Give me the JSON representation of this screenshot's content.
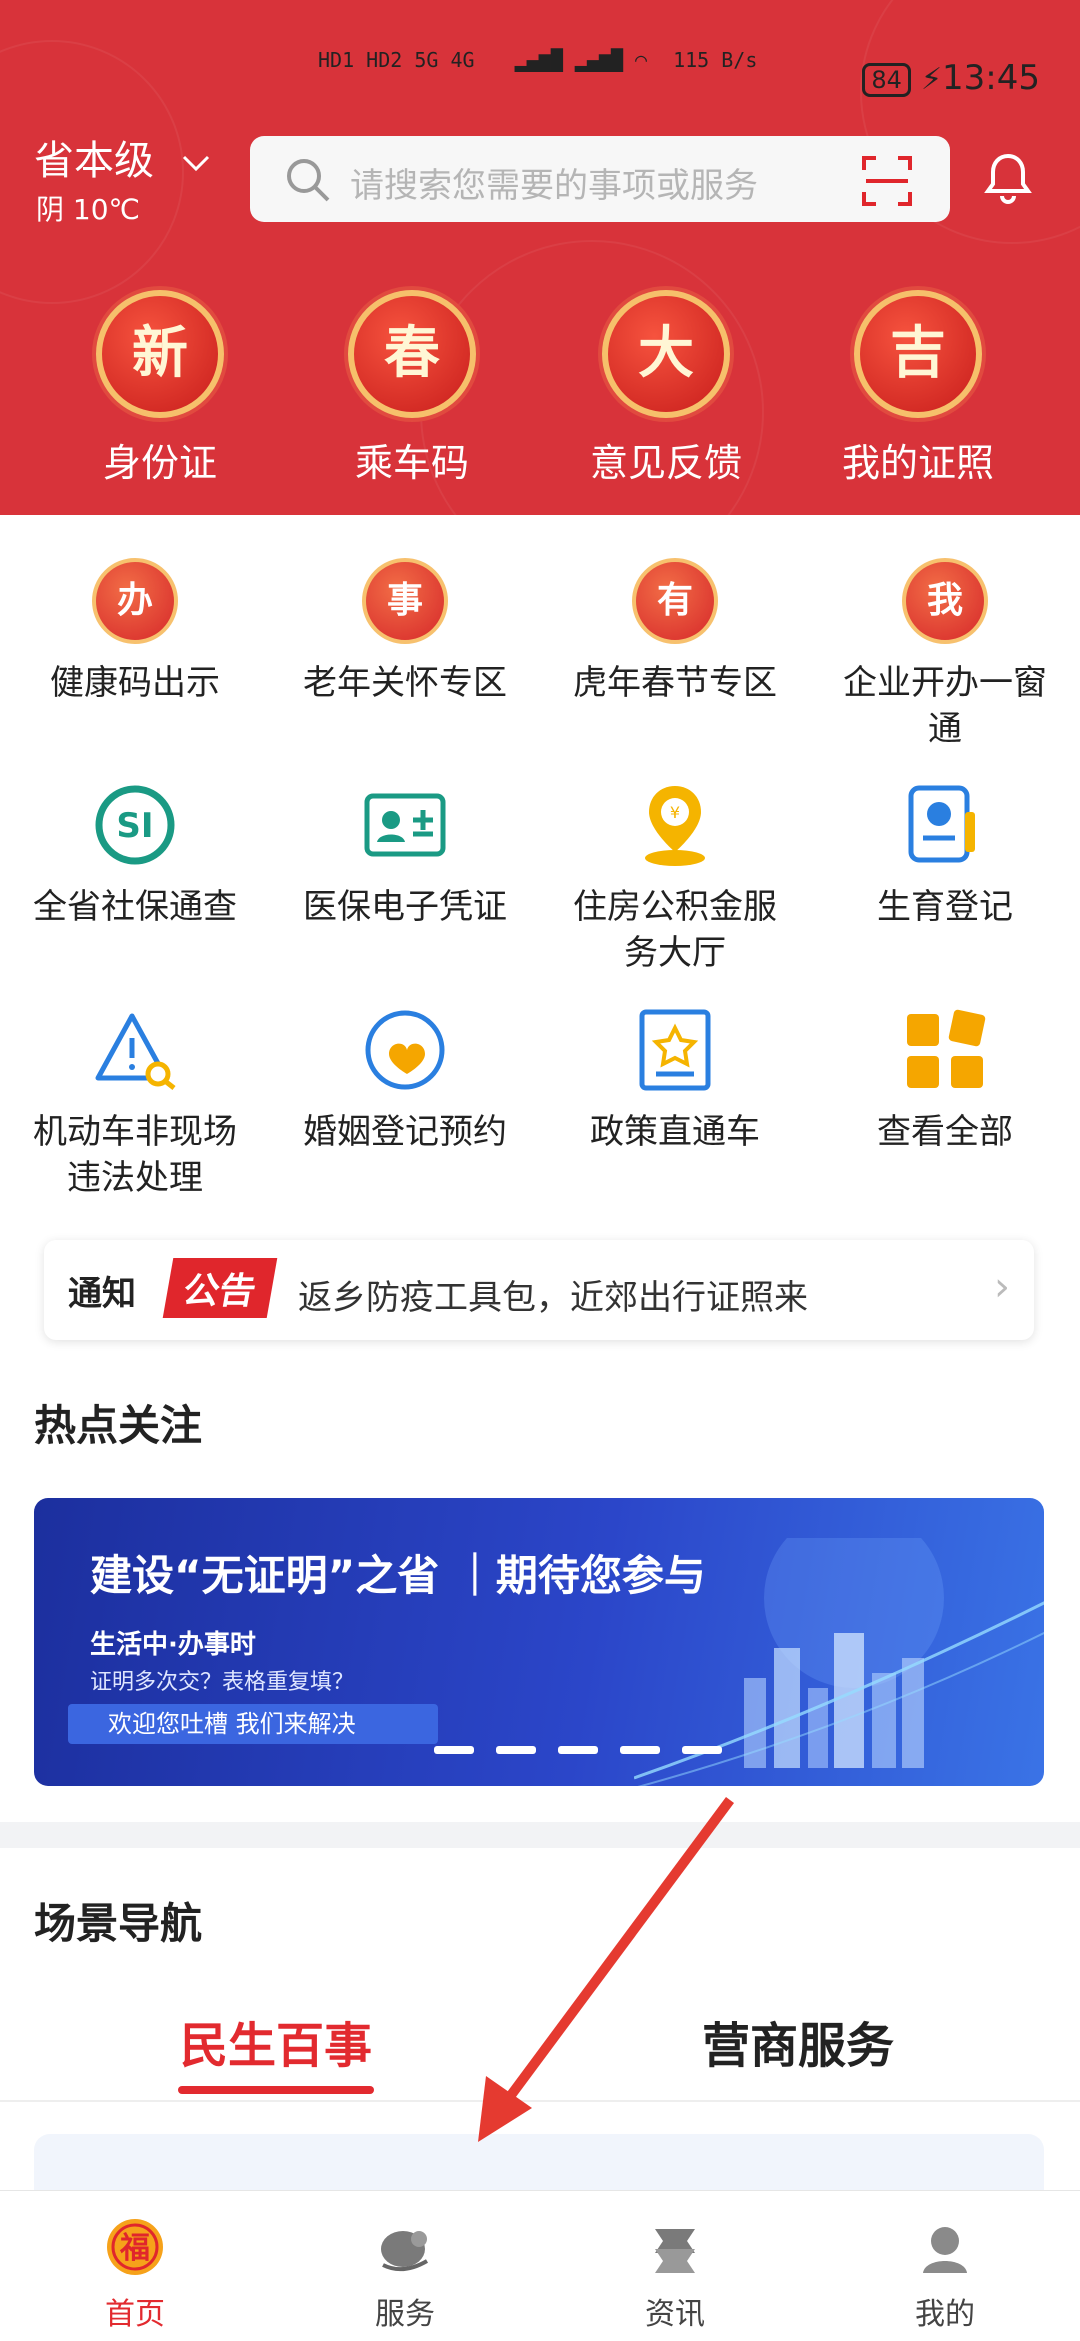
{
  "status": {
    "signals": "HD1 HD2 5G 4G",
    "speed": "115\nB/s",
    "battery": "84",
    "time": "13:45"
  },
  "header": {
    "region": "省本级",
    "weather": "阴 10℃",
    "search_placeholder": "请搜索您需要的事项或服务"
  },
  "quick_actions": [
    {
      "char": "新",
      "label": "身份证"
    },
    {
      "char": "春",
      "label": "乘车码"
    },
    {
      "char": "大",
      "label": "意见反馈"
    },
    {
      "char": "吉",
      "label": "我的证照"
    }
  ],
  "grid": [
    {
      "char": "办",
      "label": "健康码出示",
      "icon": "health-code-icon"
    },
    {
      "char": "事",
      "label": "老年关怀专区",
      "icon": "elderly-care-icon"
    },
    {
      "char": "有",
      "label": "虎年春节专区",
      "icon": "spring-festival-icon"
    },
    {
      "char": "我",
      "label": "企业开办一窗通",
      "icon": "enterprise-icon"
    },
    {
      "label": "全省社保通查",
      "icon": "social-security-icon"
    },
    {
      "label": "医保电子凭证",
      "icon": "medical-insurance-card-icon"
    },
    {
      "label": "住房公积金服务大厅",
      "icon": "housing-fund-icon"
    },
    {
      "label": "生育登记",
      "icon": "birth-registration-icon"
    },
    {
      "label": "机动车非现场违法处理",
      "icon": "traffic-violation-icon"
    },
    {
      "label": "婚姻登记预约",
      "icon": "marriage-registration-icon"
    },
    {
      "label": "政策直通车",
      "icon": "policy-express-icon"
    },
    {
      "label": "查看全部",
      "icon": "view-all-icon"
    }
  ],
  "notice": {
    "tag1": "通知",
    "tag2": "公告",
    "text": "返乡防疫工具包，近郊出行证照来"
  },
  "hot": {
    "title": "热点关注",
    "banner_title": "建设“无证明”之省 ｜期待您参与",
    "banner_sub": "生活中·办事时",
    "banner_line": "证明多次交？表格重复填？",
    "banner_button": "欢迎您吐槽 我们来解决"
  },
  "scene": {
    "title": "场景导航",
    "tabs": [
      "民生百事",
      "营商服务"
    ]
  },
  "nav": [
    {
      "label": "首页",
      "active": true
    },
    {
      "label": "服务"
    },
    {
      "label": "资讯"
    },
    {
      "label": "我的"
    }
  ],
  "colors": {
    "brand_red": "#d8333a",
    "accent_red": "#e22a2f",
    "gold": "#f6c06b"
  }
}
